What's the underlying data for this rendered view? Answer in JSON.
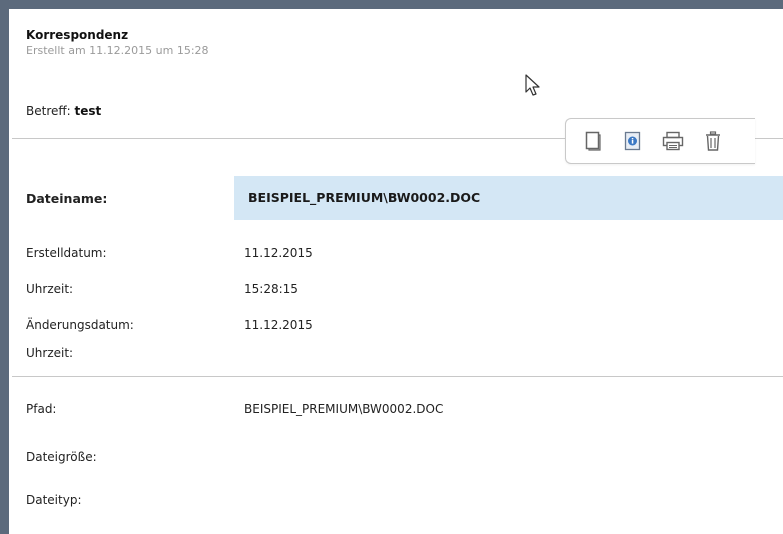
{
  "header": {
    "title": "Korrespondenz",
    "created": "Erstellt am 11.12.2015 um 15:28",
    "subject_label": "Betreff:",
    "subject_value": "test"
  },
  "toolbar": {
    "icons": [
      "document-icon",
      "info-icon",
      "print-icon",
      "trash-icon"
    ],
    "accent": "#3b78c4"
  },
  "file": {
    "name_label": "Dateiname:",
    "name_value": "BEISPIEL_PREMIUM\\BW0002.DOC",
    "highlight_color": "#d4e7f5"
  },
  "details": [
    {
      "label": "Erstelldatum:",
      "value": "11.12.2015"
    },
    {
      "label": "Uhrzeit:",
      "value": "15:28:15"
    },
    {
      "label": "Änderungsdatum:",
      "value": "11.12.2015"
    },
    {
      "label": "Uhrzeit:",
      "value": ""
    }
  ],
  "extra": [
    {
      "label": "Pfad:",
      "value": "BEISPIEL_PREMIUM\\BW0002.DOC"
    },
    {
      "label": "Dateigröße:",
      "value": ""
    },
    {
      "label": "Dateityp:",
      "value": ""
    }
  ]
}
